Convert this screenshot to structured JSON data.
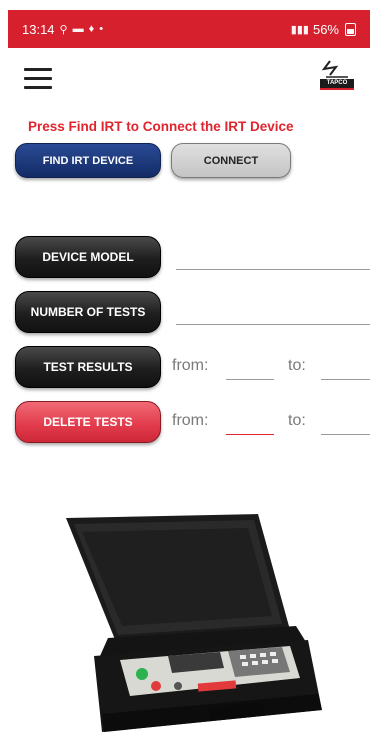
{
  "status_bar": {
    "time": "13:14",
    "battery": "56%",
    "bg_color": "#d6202e"
  },
  "app_bar": {
    "menu_icon": "hamburger-menu-icon",
    "logo_text": "TAPCO"
  },
  "instruction": "Press Find IRT to Connect the IRT Device",
  "buttons": {
    "find": "FIND IRT DEVICE",
    "connect": "CONNECT",
    "device_model": "DEVICE MODEL",
    "number_of_tests": "NUMBER OF TESTS",
    "test_results": "TEST RESULTS",
    "delete_tests": "DELETE TESTS"
  },
  "ranges": {
    "test_results": {
      "from_label": "from:",
      "to_label": "to:"
    },
    "delete_tests": {
      "from_label": "from:",
      "to_label": "to:"
    }
  },
  "colors": {
    "accent_red": "#e0252f",
    "primary_blue": "#1b3775"
  }
}
